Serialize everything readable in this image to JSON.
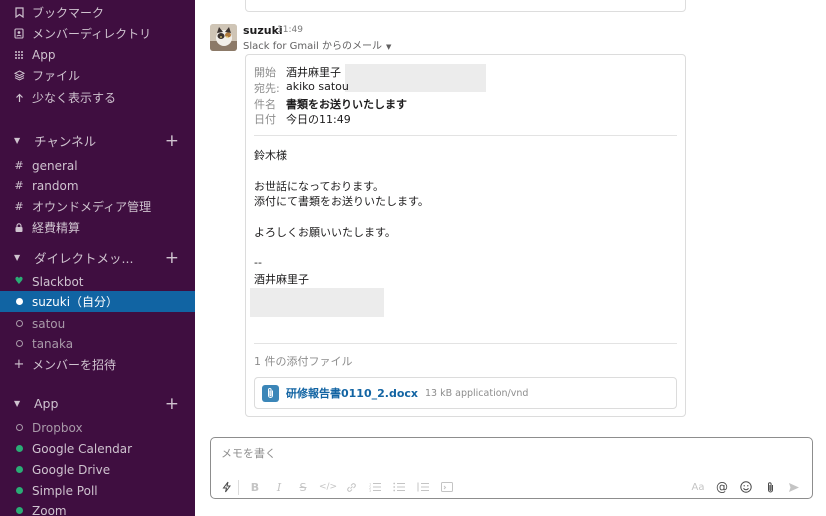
{
  "sidebar": {
    "top_items": [
      {
        "icon": "bookmark-icon",
        "label": "ブックマーク"
      },
      {
        "icon": "member-directory-icon",
        "label": "メンバーディレクトリ"
      },
      {
        "icon": "apps-grid-icon",
        "label": "App"
      },
      {
        "icon": "files-icon",
        "label": "ファイル"
      },
      {
        "icon": "arrow-up-icon",
        "label": "少なく表示する"
      }
    ],
    "channels_header": "チャンネル",
    "channels": [
      {
        "prefix": "#",
        "label": "general"
      },
      {
        "prefix": "#",
        "label": "random"
      },
      {
        "prefix": "#",
        "label": "オウンドメディア管理"
      },
      {
        "prefix": "lock",
        "label": "経費精算"
      }
    ],
    "dm_header": "ダイレクトメッ...",
    "dms": [
      {
        "status": "heart",
        "label": "Slackbot"
      },
      {
        "status": "online-self",
        "label": "suzuki（自分）"
      },
      {
        "status": "away",
        "label": "satou"
      },
      {
        "status": "away",
        "label": "tanaka"
      },
      {
        "status": "plus",
        "label": "メンバーを招待"
      }
    ],
    "apps_header": "App",
    "apps": [
      {
        "status": "away",
        "label": "Dropbox"
      },
      {
        "status": "online",
        "label": "Google Calendar"
      },
      {
        "status": "online",
        "label": "Google Drive"
      },
      {
        "status": "online",
        "label": "Simple Poll"
      },
      {
        "status": "online",
        "label": "Zoom"
      }
    ]
  },
  "message": {
    "user": "suzuki",
    "time": "11:49",
    "subtitle": "Slack for Gmail からのメール"
  },
  "email": {
    "from_label": "開始",
    "from_value": "酒井麻里子",
    "to_label": "宛先:",
    "to_value": "akiko satou",
    "subject_label": "件名",
    "subject_value": "書類をお送りいたします",
    "date_label": "日付",
    "date_value": "今日の11:49",
    "body": [
      "鈴木様",
      "",
      "お世話になっております。",
      "添付にて書類をお送りいたします。",
      "",
      "よろしくお願いいたします。",
      "",
      "--",
      "酒井麻里子"
    ],
    "attachments_title": "1 件の添付ファイル",
    "attachment_name": "研修報告書0110_2.docx",
    "attachment_meta": "13 kB application/vnd"
  },
  "composer": {
    "placeholder": "メモを書く",
    "format_size_label": "Aa"
  },
  "colors": {
    "sidebar_bg": "#3f0e40",
    "active_bg": "#1164a3",
    "online": "#2bac76",
    "link": "#1264a3"
  }
}
